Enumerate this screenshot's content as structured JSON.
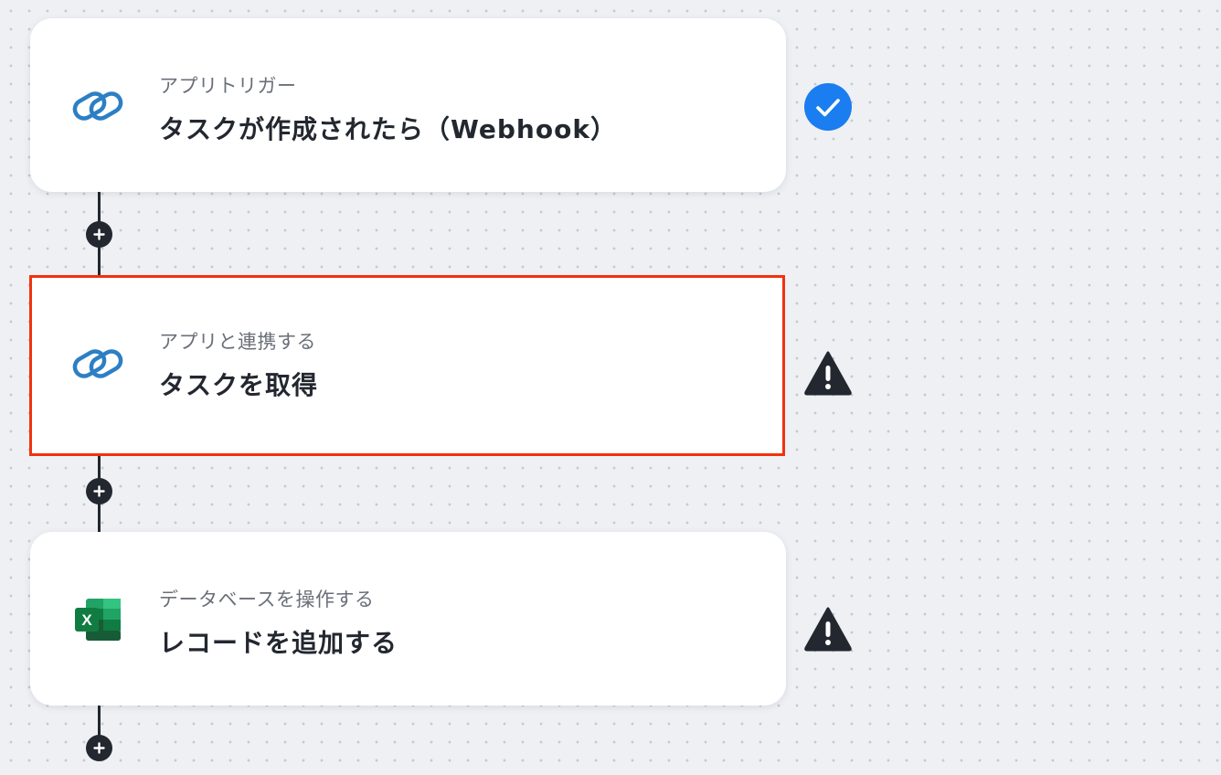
{
  "flow": {
    "steps": [
      {
        "subtitle": "アプリトリガー",
        "title": "タスクが作成されたら（Webhook）",
        "app_icon": "zoho-link-icon",
        "status": "success-check-icon",
        "selected": false
      },
      {
        "subtitle": "アプリと連携する",
        "title": "タスクを取得",
        "app_icon": "zoho-link-icon",
        "status": "warning-icon",
        "selected": true
      },
      {
        "subtitle": "データベースを操作する",
        "title": "レコードを追加する",
        "app_icon": "excel-icon",
        "status": "warning-icon",
        "selected": false
      }
    ]
  },
  "colors": {
    "background": "#eef0f4",
    "card": "#ffffff",
    "selection_outline": "#f1320f",
    "success": "#1a7df0",
    "warning": "#23272f",
    "connector": "#23272f",
    "link_icon_blue": "#2c7fc4",
    "excel_green": "#1e7145"
  }
}
